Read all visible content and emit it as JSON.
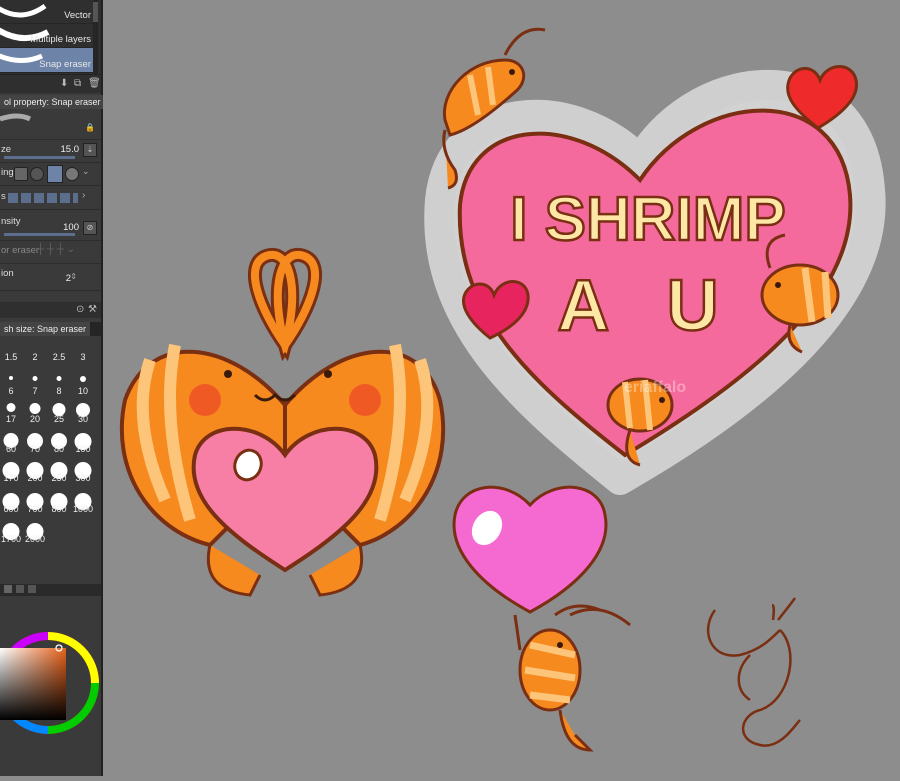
{
  "subtools": [
    {
      "label": "Vector",
      "selected": false
    },
    {
      "label": "Multiple layers",
      "selected": false
    },
    {
      "label": "Snap eraser",
      "selected": true
    }
  ],
  "tool_property": {
    "tab_label": "ol property: Snap eraser",
    "size": {
      "label": "ze",
      "value": "15.0"
    },
    "antialiasing": {
      "label": "ing"
    },
    "shape": {
      "label": "s"
    },
    "density": {
      "label": "nsity",
      "value": "100"
    },
    "vector_eraser": {
      "label": "or eraser"
    },
    "stabilization": {
      "label": "ion",
      "value": "2"
    }
  },
  "brush_size": {
    "tab_label": "sh size: Snap eraser",
    "sizes": [
      "1.5",
      "2",
      "2.5",
      "3",
      "6",
      "7",
      "8",
      "10",
      "17",
      "20",
      "25",
      "30",
      "60",
      "70",
      "80",
      "100",
      "170",
      "200",
      "250",
      "300",
      "600",
      "700",
      "800",
      "1000",
      "1700",
      "2000"
    ],
    "selected": "15.0"
  },
  "canvas_text": {
    "heart_line1": "I SHRIMP",
    "heart_line2": "A U",
    "watermark": "eriaffalo"
  },
  "colors": {
    "accent": "#6d84a8",
    "panel": "#3a3a3a",
    "canvas_bg": "#8d8d8d",
    "heart_pink": "#f56a9c",
    "shrimp_orange": "#f78a1f",
    "outline_brown": "#7a2e12",
    "letter_cream": "#fde7a6"
  }
}
